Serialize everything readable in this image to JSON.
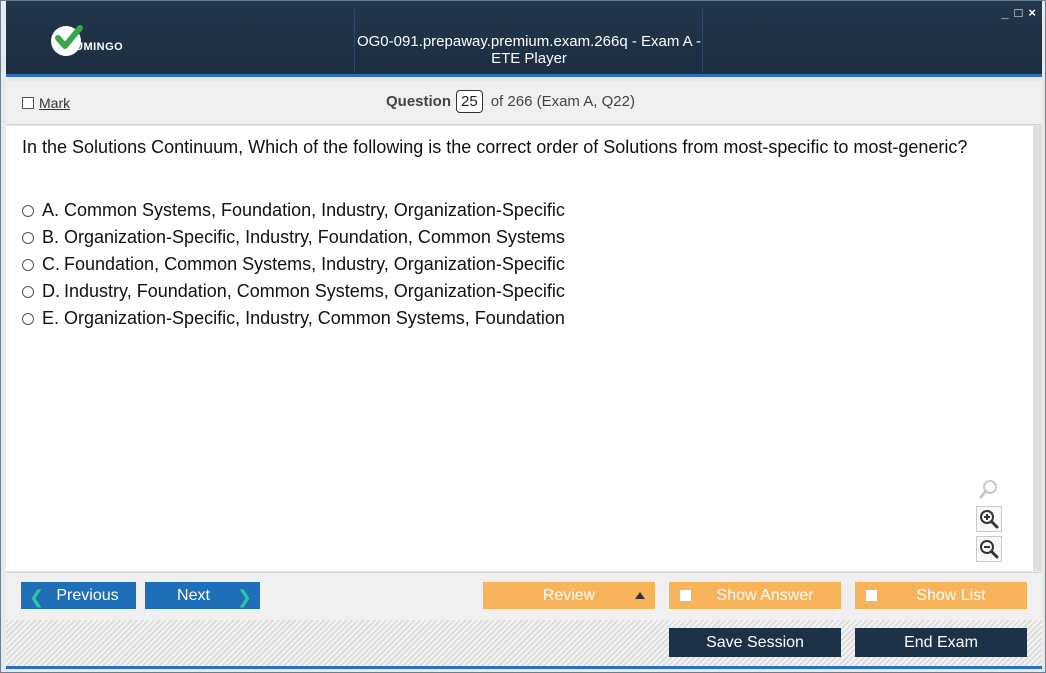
{
  "window": {
    "title": "OG0-091.prepaway.premium.exam.266q - Exam A - ETE Player",
    "logo_text": "UMINGO",
    "controls": [
      "_",
      "□",
      "×"
    ]
  },
  "header": {
    "mark_label": "Mark",
    "question_label": "Question",
    "question_number": "25",
    "question_of": "of 266 (Exam A, Q22)"
  },
  "question": {
    "text": "In the Solutions Continuum, Which of the following is the correct order of Solutions from most-specific to most-generic?",
    "options": [
      {
        "letter": "A.",
        "text": "Common Systems, Foundation, Industry, Organization-Specific"
      },
      {
        "letter": "B.",
        "text": "Organization-Specific, Industry, Foundation, Common Systems"
      },
      {
        "letter": "C.",
        "text": "Foundation, Common Systems, Industry, Organization-Specific"
      },
      {
        "letter": "D.",
        "text": "Industry, Foundation, Common Systems, Organization-Specific"
      },
      {
        "letter": "E.",
        "text": "Organization-Specific, Industry, Common Systems, Foundation"
      }
    ]
  },
  "zoom": {
    "icons": [
      "search-icon",
      "zoom-in-icon",
      "zoom-out-icon"
    ]
  },
  "nav": {
    "previous_label": "Previous",
    "next_label": "Next",
    "review_label": "Review",
    "show_answer_label": "Show Answer",
    "show_list_label": "Show List",
    "save_session_label": "Save Session",
    "end_exam_label": "End Exam"
  },
  "colors": {
    "titlebar": "#1f3144",
    "accent_blue": "#2e6fbd",
    "nav_blue": "#1f6fb8",
    "orange": "#f9b35b",
    "dark_button": "#1d3147",
    "chevron": "#2ec4a6"
  }
}
